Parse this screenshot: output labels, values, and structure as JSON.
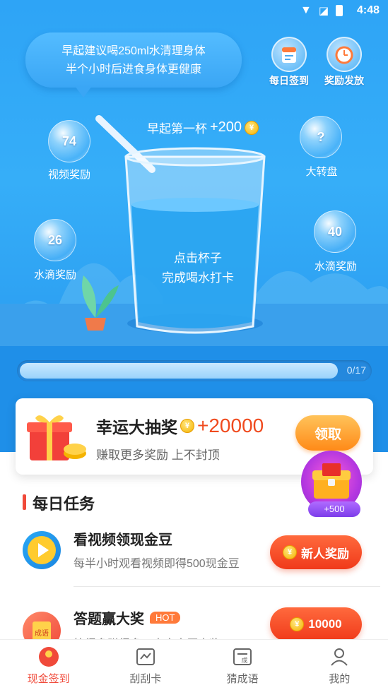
{
  "status_bar": {
    "time": "4:48"
  },
  "hero": {
    "bubble_lines": [
      "早起建议喝250ml水清理身体",
      "半个小时后进食身体更健康"
    ],
    "daily_checkin_label": "每日签到",
    "reward_release_label": "奖励发放",
    "cup_title": "早起第一杯",
    "cup_reward": "+200",
    "cup_text_lines": [
      "点击杯子",
      "完成喝水打卡"
    ],
    "orbs": [
      {
        "value": "74",
        "label": "视频奖励"
      },
      {
        "value": "?",
        "label": "大转盘"
      },
      {
        "value": "26",
        "label": "水滴奖励"
      },
      {
        "value": "40",
        "label": "水滴奖励"
      }
    ],
    "progress": {
      "text": "0/17",
      "fraction": 0.91
    }
  },
  "lucky_draw": {
    "title": "幸运大抽奖",
    "amount": "+20000",
    "subtitle": "赚取更多奖励 上不封顶",
    "button": "领取",
    "chest_badge": "+500"
  },
  "tasks_section": {
    "title": "每日任务"
  },
  "tasks": [
    {
      "title": "看视频领现金豆",
      "subtitle": "每半小时观看视频即得500现金豆",
      "button": "新人奖励",
      "hot": ""
    },
    {
      "title": "答题赢大奖",
      "subtitle": "答得多赚得多，高产丰厚大奖",
      "button": "10000",
      "hot": "HOT"
    }
  ],
  "tabs": [
    {
      "label": "现金签到"
    },
    {
      "label": "刮刮卡"
    },
    {
      "label": "猜成语"
    },
    {
      "label": "我的"
    }
  ],
  "colors": {
    "accent": "#f04a3a",
    "primary_blue": "#2ea4f6",
    "gold": "#f5b300"
  }
}
